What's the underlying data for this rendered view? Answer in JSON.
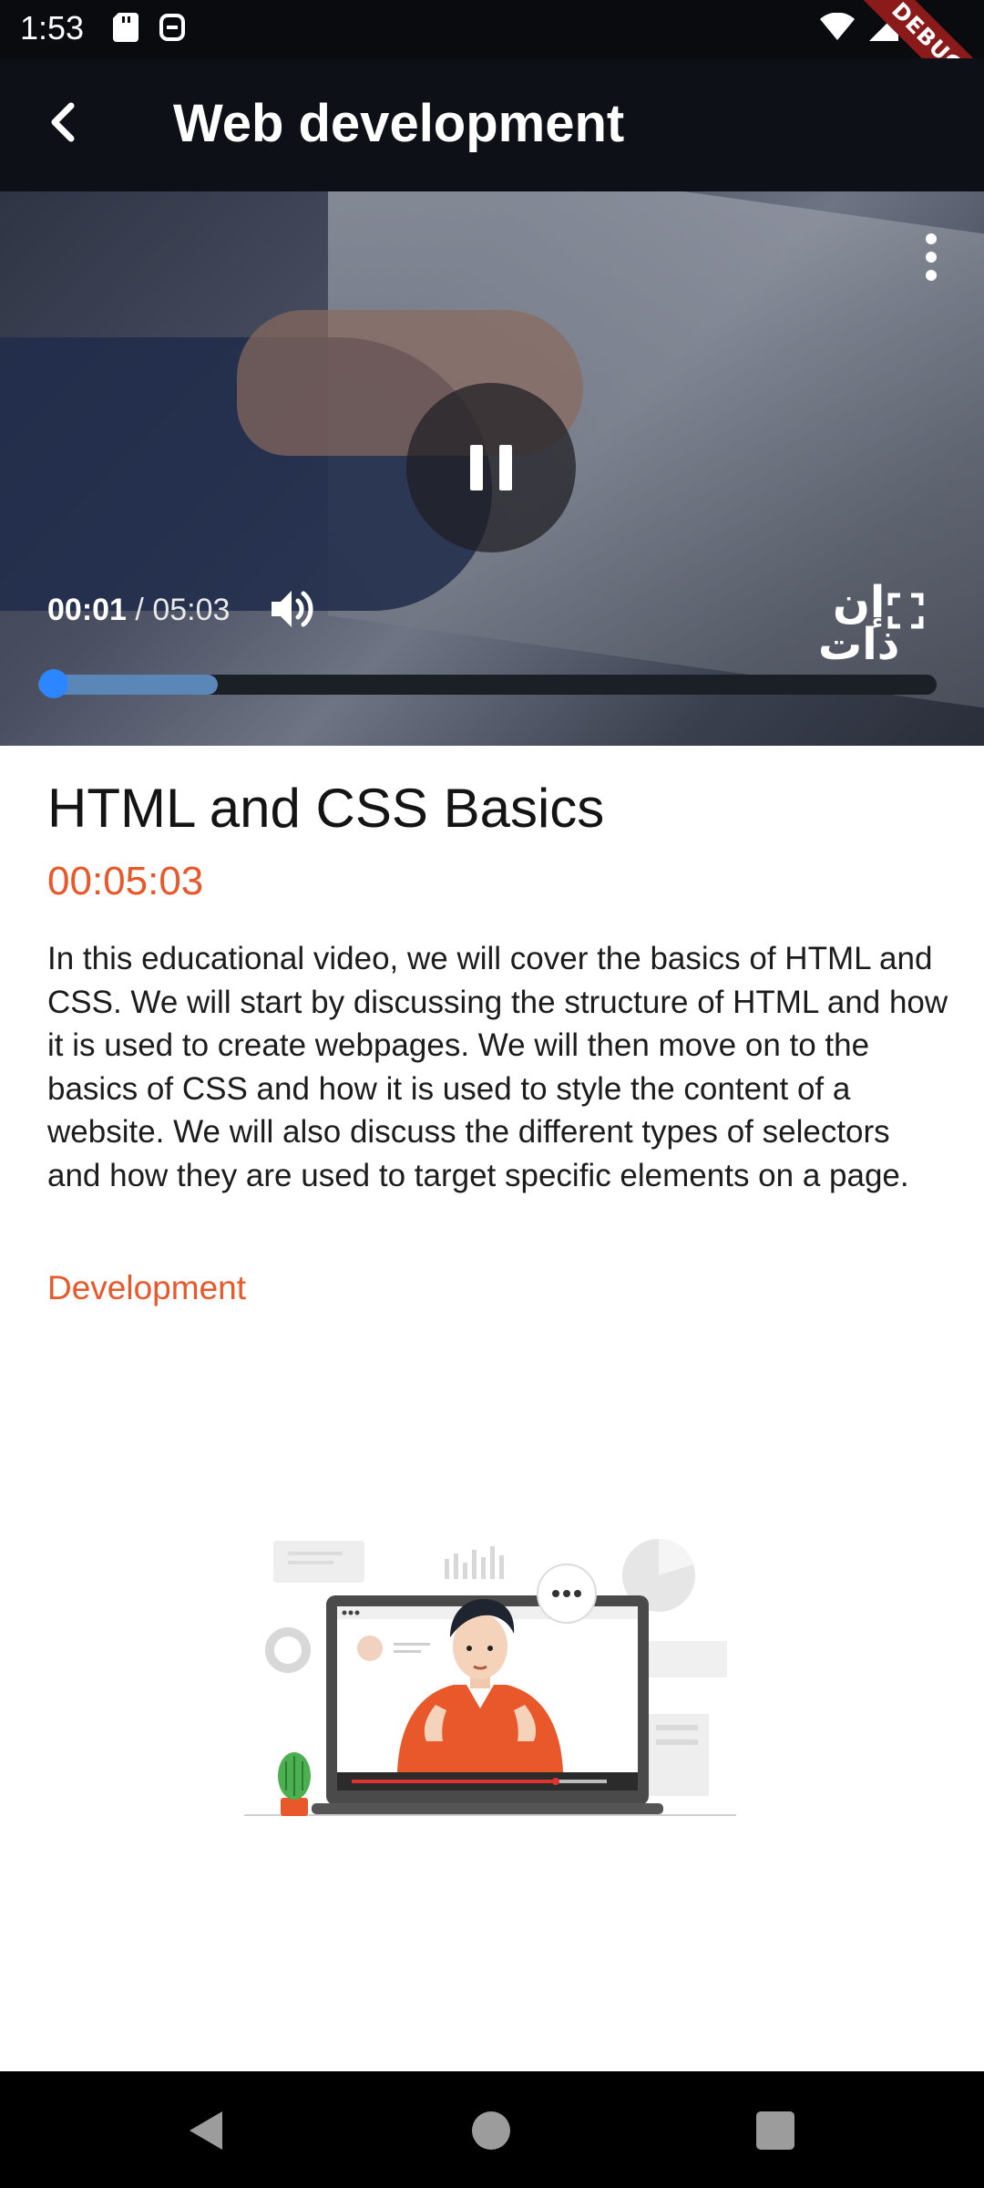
{
  "status_bar": {
    "time": "1:53",
    "debug_label": "DEBUG",
    "icons": [
      "sd-card-icon",
      "notification-icon",
      "wifi-icon",
      "signal-icon",
      "battery-icon"
    ]
  },
  "app_bar": {
    "title": "Web development",
    "back_icon": "back-arrow-icon"
  },
  "player": {
    "state": "playing",
    "current_time": "00:01",
    "separator": "/",
    "total_time": "05:03",
    "progress": 0.003,
    "buffered": 0.2,
    "watermark_line1": "إن",
    "watermark_line2": "ذات",
    "icons": [
      "more-vertical-icon",
      "pause-icon",
      "volume-icon",
      "fullscreen-icon"
    ]
  },
  "video": {
    "title": "HTML and CSS Basics",
    "duration": "00:05:03",
    "description": "In this educational video, we will cover the basics of HTML and CSS. We will start by discussing the structure of HTML and how it is used to create webpages. We will then move on to the basics of CSS and how it is used to style the content of a website. We will also discuss the different types of selectors and how they are used to target specific elements on a page.",
    "category": "Development"
  },
  "colors": {
    "accent": "#e8582a",
    "progress_thumb": "#2b86ff",
    "app_bar": "#0d1016"
  }
}
